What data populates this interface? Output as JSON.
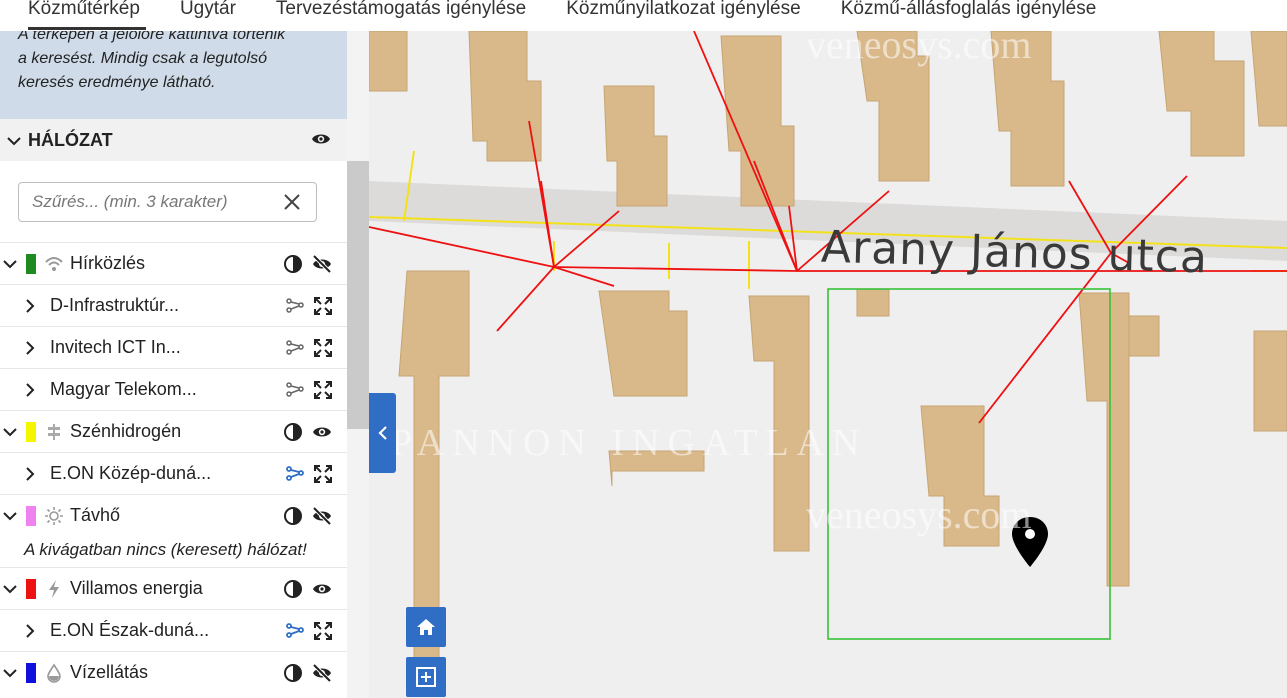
{
  "tabs": [
    {
      "label": "Közműtérkép",
      "active": true
    },
    {
      "label": "Ügytár"
    },
    {
      "label": "Tervezéstámogatás igénylése"
    },
    {
      "label": "Közműnyilatkozat igénylése"
    },
    {
      "label": "Közmű-állásfoglalás igénylése"
    }
  ],
  "info": {
    "line0": "A térképen a jelölőre kattintva történik",
    "line1": "a keresést. Mindig csak a legutolsó",
    "line2": "keresés eredménye látható."
  },
  "network": {
    "title": "HÁLÓZAT",
    "filter_placeholder": "Szűrés... (min. 3 karakter)",
    "empty_note": "A kivágatban nincs (keresett) hálózat!",
    "groups": [
      {
        "label": "Hírközlés",
        "color": "#1f8a1f",
        "icon": "wifi-icon",
        "visible": false,
        "children": [
          "D-Infrastruktúr...",
          "Invitech ICT In...",
          "Magyar Telekom..."
        ]
      },
      {
        "label": "Szénhidrogén",
        "color": "#f5f500",
        "icon": "gas-icon",
        "visible": true,
        "children": [
          "E.ON Közép-duná..."
        ]
      },
      {
        "label": "Távhő",
        "color": "#ee82ee",
        "icon": "sun-icon",
        "visible": false,
        "children": []
      },
      {
        "label": "Villamos energia",
        "color": "#ee1111",
        "icon": "bolt-icon",
        "visible": true,
        "children": [
          "E.ON Észak-duná..."
        ]
      },
      {
        "label": "Vízellátás",
        "color": "#1010dd",
        "icon": "drop-icon",
        "visible": false,
        "children": []
      }
    ]
  },
  "map": {
    "street_name": "Arany János utca",
    "watermark_site": "veneosys.com",
    "watermark_agency": "PANNON INGATLAN"
  },
  "colors": {
    "accent": "#2f6ec4",
    "building": "#d9b889",
    "power_line": "#ee1111",
    "gas_line": "#f3e21a",
    "selection": "#38c238"
  }
}
